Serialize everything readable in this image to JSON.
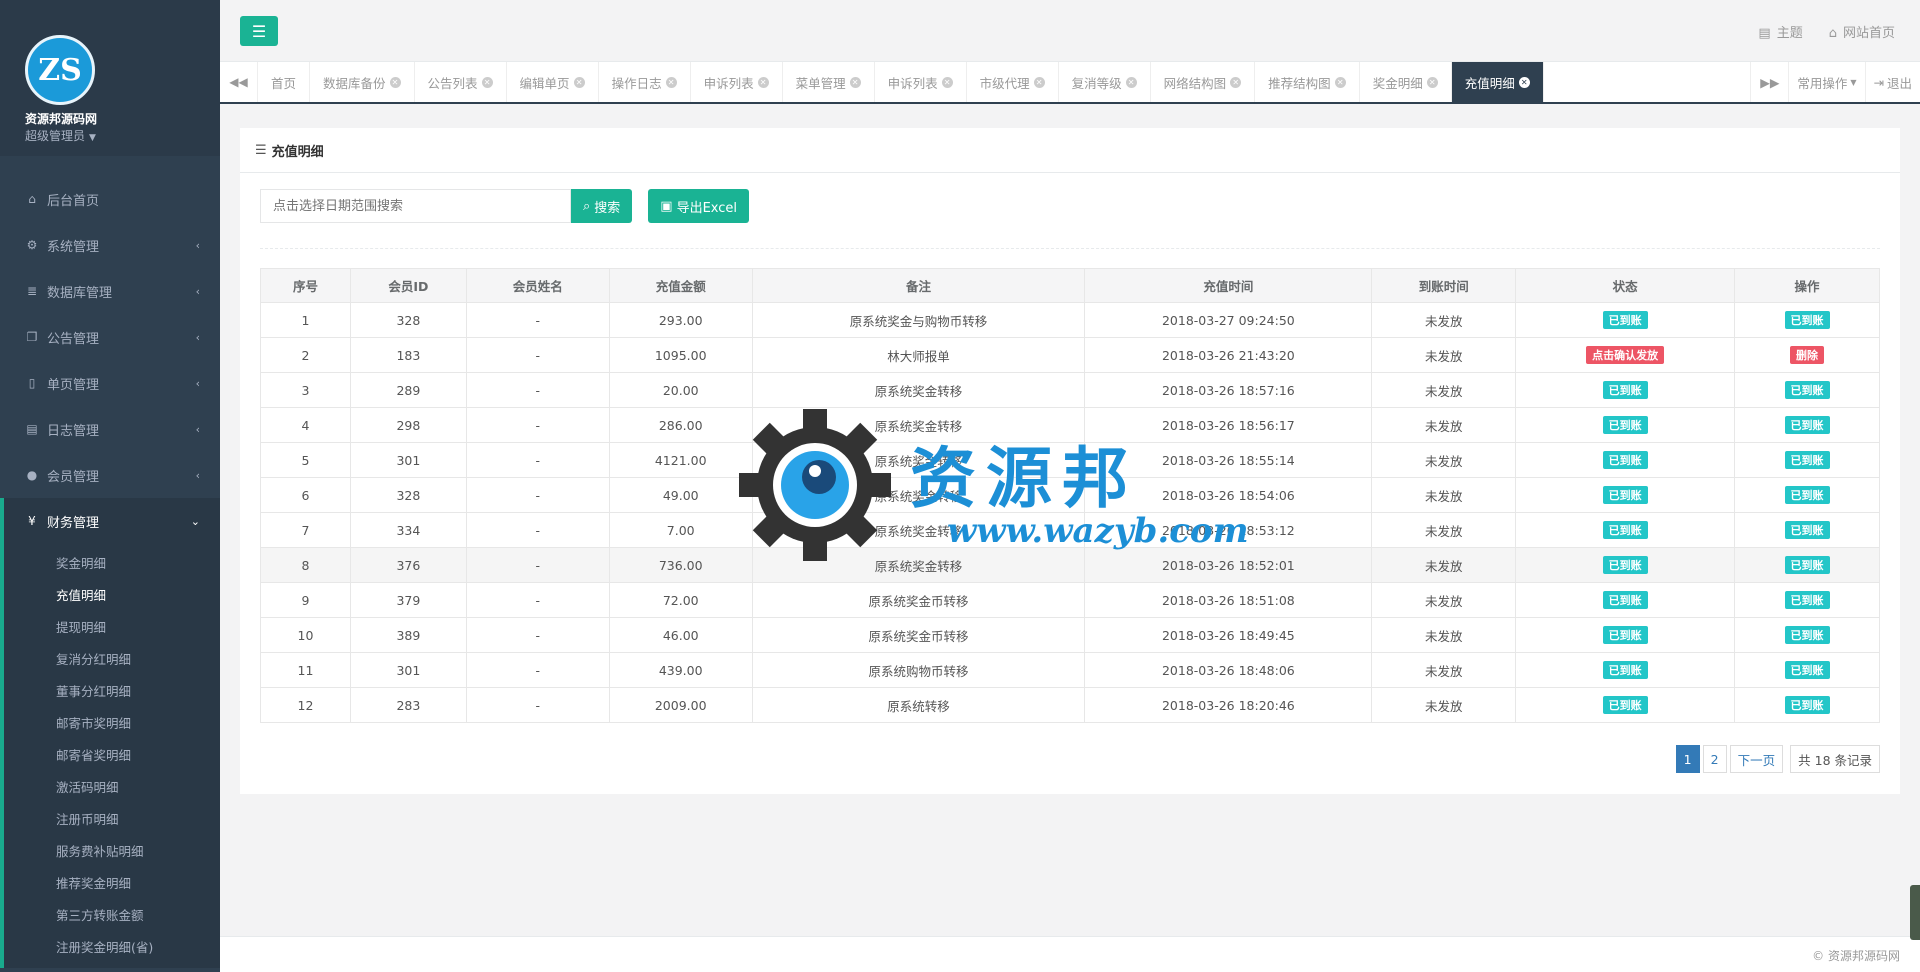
{
  "brand": {
    "site_name": "资源邦源码网",
    "role": "超级管理员",
    "logo_text": "ZS"
  },
  "nav": {
    "items": [
      {
        "label": "后台首页",
        "icon": "home-icon"
      },
      {
        "label": "系统管理",
        "icon": "gear-icon"
      },
      {
        "label": "数据库管理",
        "icon": "database-icon"
      },
      {
        "label": "公告管理",
        "icon": "copy-icon"
      },
      {
        "label": "单页管理",
        "icon": "file-icon"
      },
      {
        "label": "日志管理",
        "icon": "log-icon"
      },
      {
        "label": "会员管理",
        "icon": "user-icon"
      },
      {
        "label": "财务管理",
        "icon": "yen-icon"
      }
    ],
    "finance_sub": [
      "奖金明细",
      "充值明细",
      "提现明细",
      "复消分红明细",
      "董事分红明细",
      "邮寄市奖明细",
      "邮寄省奖明细",
      "激活码明细",
      "注册币明细",
      "服务费补贴明细",
      "推荐奖金明细",
      "第三方转账金额",
      "注册奖金明细(省)"
    ]
  },
  "topbar": {
    "theme_label": "主题",
    "home_label": "网站首页"
  },
  "tabs": [
    "首页",
    "数据库备份",
    "公告列表",
    "编辑单页",
    "操作日志",
    "申诉列表",
    "菜单管理",
    "申诉列表",
    "市级代理",
    "复消等级",
    "网络结构图",
    "推荐结构图",
    "奖金明细",
    "充值明细"
  ],
  "tabs_right": {
    "common_ops": "常用操作",
    "logout": "退出"
  },
  "panel": {
    "title": "充值明细",
    "search_placeholder": "点击选择日期范围搜索",
    "search_btn": "搜索",
    "export_btn": "导出Excel"
  },
  "table": {
    "headers": [
      "序号",
      "会员ID",
      "会员姓名",
      "充值金额",
      "备注",
      "充值时间",
      "到账时间",
      "状态",
      "操作"
    ],
    "rows": [
      [
        "1",
        "328",
        "-",
        "293.00",
        "原系统奖金与购物币转移",
        "2018-03-27 09:24:50",
        "未发放",
        "已到账",
        "已到账"
      ],
      [
        "2",
        "183",
        "-",
        "1095.00",
        "林大师报单",
        "2018-03-26 21:43:20",
        "未发放",
        "点击确认发放",
        "删除"
      ],
      [
        "3",
        "289",
        "-",
        "20.00",
        "原系统奖金转移",
        "2018-03-26 18:57:16",
        "未发放",
        "已到账",
        "已到账"
      ],
      [
        "4",
        "298",
        "-",
        "286.00",
        "原系统奖金转移",
        "2018-03-26 18:56:17",
        "未发放",
        "已到账",
        "已到账"
      ],
      [
        "5",
        "301",
        "-",
        "4121.00",
        "原系统奖金转移",
        "2018-03-26 18:55:14",
        "未发放",
        "已到账",
        "已到账"
      ],
      [
        "6",
        "328",
        "-",
        "49.00",
        "原系统奖金转移",
        "2018-03-26 18:54:06",
        "未发放",
        "已到账",
        "已到账"
      ],
      [
        "7",
        "334",
        "-",
        "7.00",
        "原系统奖金转移",
        "2018-03-26 18:53:12",
        "未发放",
        "已到账",
        "已到账"
      ],
      [
        "8",
        "376",
        "-",
        "736.00",
        "原系统奖金转移",
        "2018-03-26 18:52:01",
        "未发放",
        "已到账",
        "已到账"
      ],
      [
        "9",
        "379",
        "-",
        "72.00",
        "原系统奖金币转移",
        "2018-03-26 18:51:08",
        "未发放",
        "已到账",
        "已到账"
      ],
      [
        "10",
        "389",
        "-",
        "46.00",
        "原系统奖金币转移",
        "2018-03-26 18:49:45",
        "未发放",
        "已到账",
        "已到账"
      ],
      [
        "11",
        "301",
        "-",
        "439.00",
        "原系统购物币转移",
        "2018-03-26 18:48:06",
        "未发放",
        "已到账",
        "已到账"
      ],
      [
        "12",
        "283",
        "-",
        "2009.00",
        "原系统转移",
        "2018-03-26 18:20:46",
        "未发放",
        "已到账",
        "已到账"
      ]
    ]
  },
  "pager": {
    "pages": [
      "1",
      "2"
    ],
    "next": "下一页",
    "total": "共 18 条记录"
  },
  "watermark": {
    "text": "资源邦",
    "url": "www.wazyb.com"
  },
  "footer": {
    "copyright": "© 资源邦源码网"
  }
}
